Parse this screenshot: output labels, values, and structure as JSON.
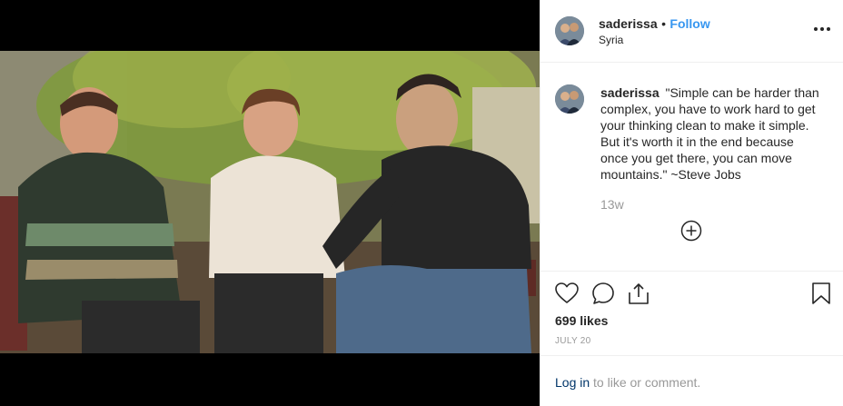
{
  "post": {
    "username": "saderissa",
    "separator": "•",
    "follow_label": "Follow",
    "location": "Syria",
    "caption_text": "\"Simple can be harder than complex, you have to work hard to get your thinking clean to make it simple. But it's worth it in the end because once you get there, you can move mountains.\" ~Steve Jobs",
    "age": "13w",
    "likes": "699 likes",
    "date": "JULY 20",
    "login_link": "Log in",
    "login_rest": " to like or comment."
  },
  "icons": {
    "more": "more-options-icon",
    "add_comment": "plus-circle-icon",
    "like": "heart-icon",
    "comment": "comment-bubble-icon",
    "share": "share-icon",
    "save": "bookmark-icon"
  },
  "colors": {
    "link": "#3897f0",
    "login_link": "#003569",
    "muted": "#999999",
    "text": "#262626"
  }
}
